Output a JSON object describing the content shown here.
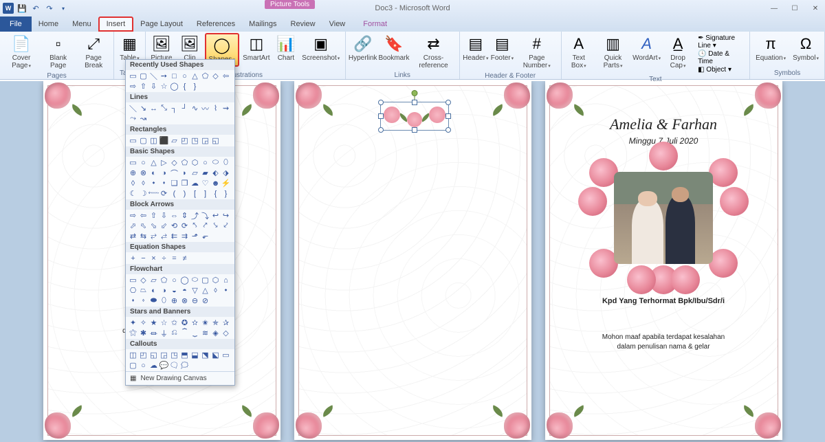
{
  "app": {
    "title": "Doc3 - Microsoft Word",
    "contextual_group": "Picture Tools"
  },
  "tabs": {
    "file": "File",
    "home": "Home",
    "menu": "Menu",
    "insert": "Insert",
    "page_layout": "Page Layout",
    "references": "References",
    "mailings": "Mailings",
    "review": "Review",
    "view": "View",
    "format": "Format"
  },
  "ribbon": {
    "groups": {
      "pages": "Pages",
      "tables": "Tables",
      "illustrations": "Illustrations",
      "links": "Links",
      "header_footer": "Header & Footer",
      "text": "Text",
      "symbols": "Symbols"
    },
    "buttons": {
      "cover_page": "Cover\nPage",
      "blank_page": "Blank\nPage",
      "page_break": "Page\nBreak",
      "table": "Table",
      "picture": "Picture",
      "clip_art": "Clip\nArt",
      "shapes": "Shapes",
      "smartart": "SmartArt",
      "chart": "Chart",
      "screenshot": "Screenshot",
      "hyperlink": "Hyperlink",
      "bookmark": "Bookmark",
      "cross_reference": "Cross-reference",
      "header": "Header",
      "footer": "Footer",
      "page_number": "Page\nNumber",
      "text_box": "Text\nBox",
      "quick_parts": "Quick\nParts",
      "wordart": "WordArt",
      "drop_cap": "Drop\nCap",
      "signature_line": "Signature Line",
      "date_time": "Date & Time",
      "object": "Object",
      "equation": "Equation",
      "symbol": "Symbol"
    }
  },
  "shapes_dropdown": {
    "sections": {
      "recent": "Recently Used Shapes",
      "lines": "Lines",
      "rectangles": "Rectangles",
      "basic": "Basic Shapes",
      "arrows": "Block Arrows",
      "equation": "Equation Shapes",
      "flowchart": "Flowchart",
      "stars": "Stars and Banners",
      "callouts": "Callouts"
    },
    "footer": "New Drawing Canvas"
  },
  "doc": {
    "page1": {
      "line1": "dengan Ali Bin Abi Thalib)"
    },
    "page3": {
      "names": "Amelia & Farhan",
      "date": "Minggu 7 Juli 2020",
      "caption": "Kpd Yang Terhormat Bpk/Ibu/Sdr/i",
      "footer1": "Mohon maaf apabila terdapat kesalahan",
      "footer2": "dalam penulisan nama & gelar"
    }
  }
}
